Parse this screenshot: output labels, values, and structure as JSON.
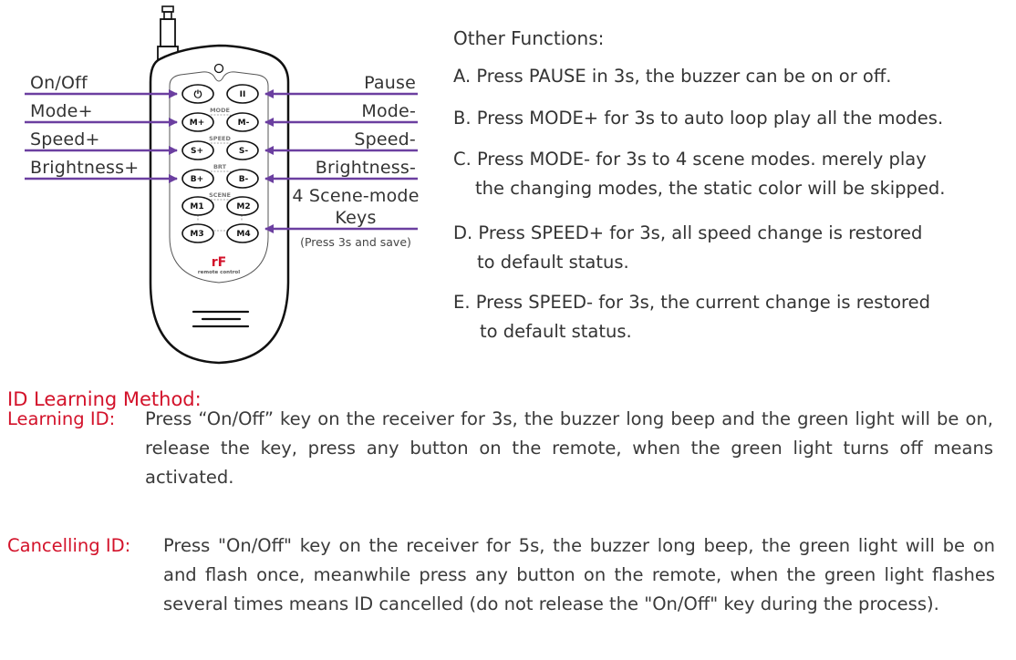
{
  "remote": {
    "left_labels": [
      "On/Off",
      "Mode+",
      "Speed+",
      "Brightness+"
    ],
    "right_labels": [
      "Pause",
      "Mode-",
      "Speed-",
      "Brightness-"
    ],
    "scene_label_line1": "4 Scene-mode",
    "scene_label_line2": "Keys",
    "scene_note": "(Press 3s and save)",
    "buttons": {
      "power": "⏻",
      "pause": "II",
      "mode_plus": "M+",
      "mode_minus": "M-",
      "speed_plus": "S+",
      "speed_minus": "S-",
      "brt_plus": "B+",
      "brt_minus": "B-",
      "m1": "M1",
      "m2": "M2",
      "m3": "M3",
      "m4": "M4"
    },
    "group_labels": {
      "mode": "MODE",
      "speed": "SPEED",
      "brt": "BRT",
      "scene": "SCENE"
    },
    "logo": "rF",
    "logo_caption": "remote control",
    "arrow_color": "#6b3fa0",
    "logo_color": "#d3122a"
  },
  "other_functions": {
    "title": "Other Functions:",
    "items": [
      {
        "line1": "A. Press PAUSE in 3s, the buzzer can be on or off.",
        "line2": ""
      },
      {
        "line1": "B. Press MODE+ for 3s to auto loop play all the modes.",
        "line2": ""
      },
      {
        "line1": "C. Press MODE- for 3s to 4 scene modes. merely play",
        "line2": "the changing modes, the static color will be skipped."
      },
      {
        "line1": "D. Press SPEED+ for 3s, all speed change is restored",
        "line2": "to default status."
      },
      {
        "line1": "E. Press SPEED- for 3s, the current change is restored",
        "line2": "to default status."
      }
    ]
  },
  "id_learning": {
    "heading": "ID Learning Method:",
    "heading_color": "#d3122a",
    "learning": {
      "label": "Learning ID:",
      "text": "Press “On/Off” key on the receiver for 3s, the buzzer long beep and the green light will be on, release the key, press any button on the remote, when the green light turns off means activated."
    },
    "cancelling": {
      "label": "Cancelling ID:",
      "text": "Press \"On/Off\" key on the receiver for 5s, the buzzer long beep, the green light will be on and flash once, meanwhile press any button on the remote, when the green light flashes several times means ID cancelled (do not release the \"On/Off\" key during the process)."
    }
  }
}
